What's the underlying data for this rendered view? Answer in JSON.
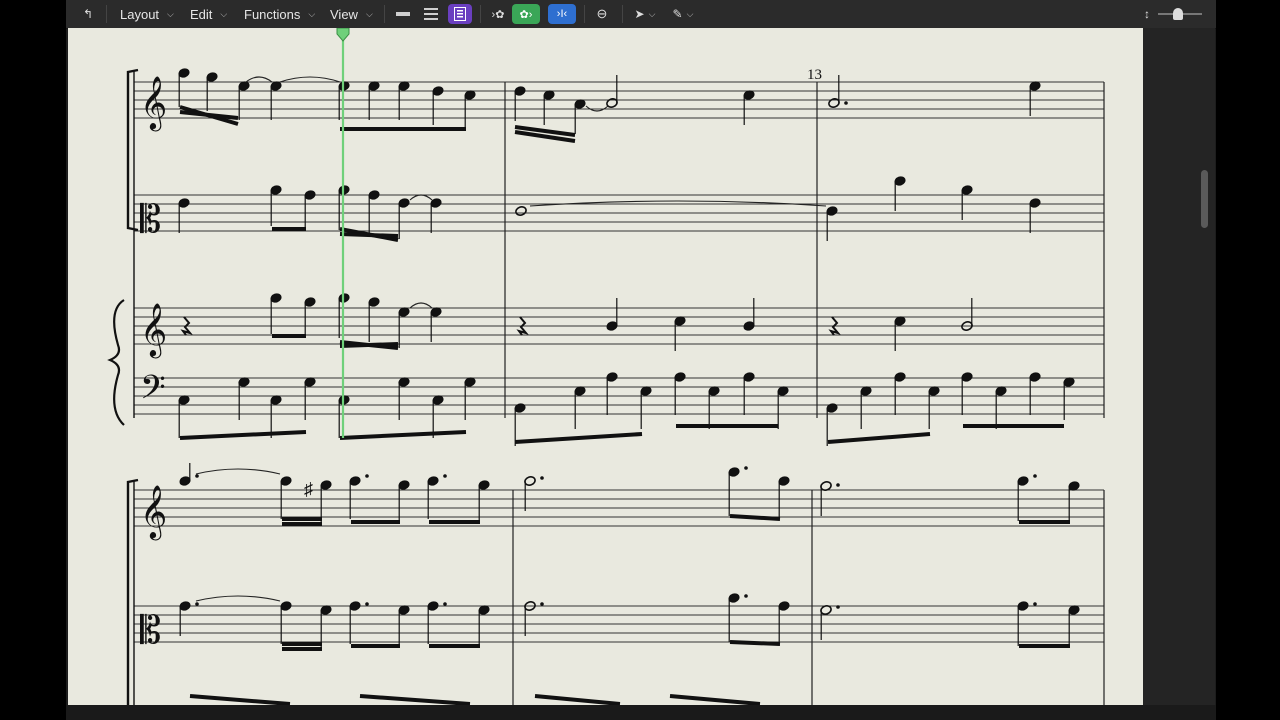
{
  "toolbar": {
    "back_icon": "arrow-up-left-icon",
    "menus": [
      {
        "label": "Layout"
      },
      {
        "label": "Edit"
      },
      {
        "label": "Functions"
      },
      {
        "label": "View"
      }
    ],
    "icons": [
      "single-line-view-icon",
      "staff-list-icon",
      "page-view-icon",
      "midi-in-icon",
      "colors-icon",
      "catch-playhead-icon",
      "link-icon",
      "pointer-tool-icon",
      "pencil-tool-icon",
      "vertical-zoom-icon"
    ],
    "accent_purple": "#6a3fc0",
    "accent_green": "#3aa657",
    "accent_blue": "#2e6fd0"
  },
  "score": {
    "measure_number": "13",
    "paper_color": "#e9e9df",
    "playhead_color": "#6fd07a"
  }
}
